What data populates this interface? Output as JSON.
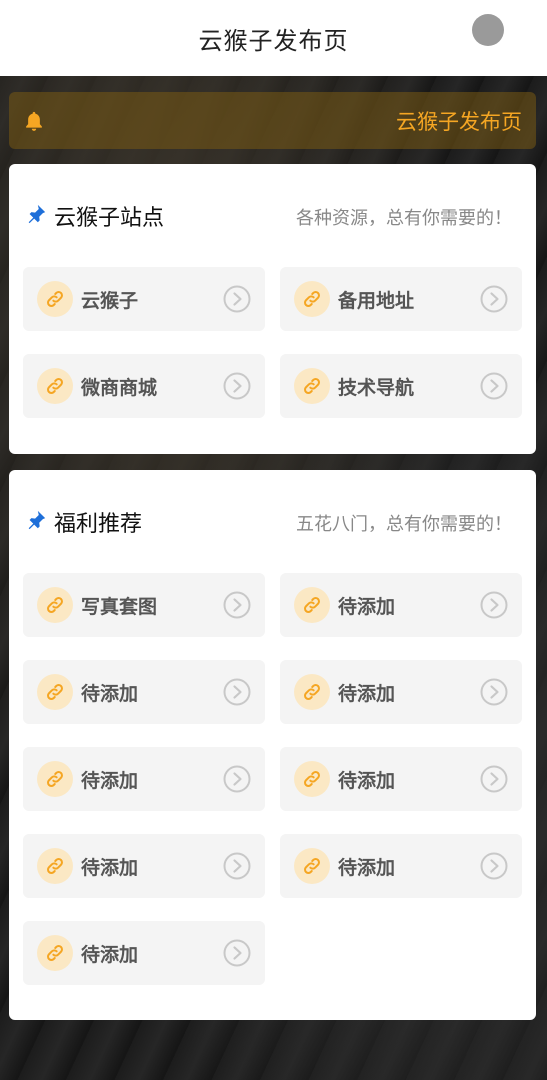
{
  "header": {
    "title": "云猴子发布页"
  },
  "notice": {
    "text": "云猴子发布页"
  },
  "colors": {
    "accent": "#f5a623",
    "pin": "#1e6fd9",
    "link_bg": "#fbe8c4"
  },
  "sections": [
    {
      "title": "云猴子站点",
      "subtitle": "各种资源，总有你需要的！",
      "items": [
        {
          "label": "云猴子"
        },
        {
          "label": "备用地址"
        },
        {
          "label": "微商商城"
        },
        {
          "label": "技术导航"
        }
      ]
    },
    {
      "title": "福利推荐",
      "subtitle": "五花八门，总有你需要的！",
      "items": [
        {
          "label": "写真套图"
        },
        {
          "label": "待添加"
        },
        {
          "label": "待添加"
        },
        {
          "label": "待添加"
        },
        {
          "label": "待添加"
        },
        {
          "label": "待添加"
        },
        {
          "label": "待添加"
        },
        {
          "label": "待添加"
        },
        {
          "label": "待添加"
        }
      ]
    }
  ]
}
